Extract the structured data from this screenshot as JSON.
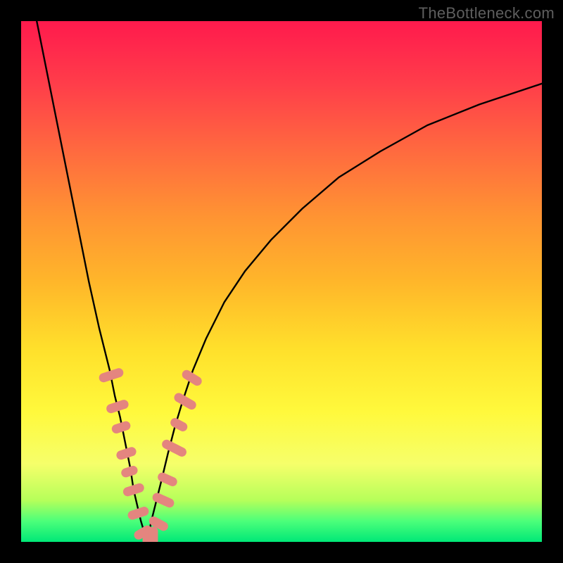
{
  "watermark": "TheBottleneck.com",
  "colors": {
    "frame": "#000000",
    "curve": "#000000",
    "marker_fill": "#e4857f",
    "marker_stroke": "#d46a63",
    "gradient_stops": [
      {
        "offset": 0.0,
        "color": "#ff1a4d"
      },
      {
        "offset": 0.12,
        "color": "#ff3d4a"
      },
      {
        "offset": 0.25,
        "color": "#ff6a3f"
      },
      {
        "offset": 0.37,
        "color": "#ff9233"
      },
      {
        "offset": 0.5,
        "color": "#ffb62a"
      },
      {
        "offset": 0.63,
        "color": "#ffe02b"
      },
      {
        "offset": 0.75,
        "color": "#fff93c"
      },
      {
        "offset": 0.85,
        "color": "#f6ff6a"
      },
      {
        "offset": 0.92,
        "color": "#b6ff5a"
      },
      {
        "offset": 0.96,
        "color": "#4cff7a"
      },
      {
        "offset": 1.0,
        "color": "#00e877"
      }
    ]
  },
  "chart_data": {
    "type": "line",
    "title": "",
    "xlabel": "",
    "ylabel": "",
    "xlim": [
      0,
      100
    ],
    "ylim": [
      0,
      100
    ],
    "series": [
      {
        "name": "bottleneck-curve-left",
        "x": [
          3,
          5,
          7,
          9,
          11,
          13,
          15,
          17,
          18,
          19,
          20,
          21,
          21.6,
          22.3,
          23,
          23.6,
          24.2
        ],
        "y": [
          100,
          90,
          80,
          70,
          60,
          50,
          41,
          33,
          28,
          24,
          19,
          14,
          10,
          7,
          4,
          2,
          0
        ]
      },
      {
        "name": "bottleneck-curve-right",
        "x": [
          24.2,
          25,
          26,
          27,
          28.2,
          29.5,
          31,
          33,
          35.5,
          39,
          43,
          48,
          54,
          61,
          69,
          78,
          88,
          100
        ],
        "y": [
          0,
          4,
          8,
          12,
          17,
          22,
          27,
          33,
          39,
          46,
          52,
          58,
          64,
          70,
          75,
          80,
          84,
          88
        ]
      }
    ],
    "markers": [
      {
        "x": 17.3,
        "y": 32,
        "angle": -72,
        "len": 4.2
      },
      {
        "x": 18.5,
        "y": 26,
        "angle": -72,
        "len": 3.8
      },
      {
        "x": 19.2,
        "y": 22,
        "angle": -72,
        "len": 3.2
      },
      {
        "x": 20.2,
        "y": 17,
        "angle": -72,
        "len": 3.4
      },
      {
        "x": 20.8,
        "y": 13.5,
        "angle": -72,
        "len": 2.8
      },
      {
        "x": 21.6,
        "y": 10,
        "angle": -72,
        "len": 3.6
      },
      {
        "x": 22.5,
        "y": 5.5,
        "angle": -72,
        "len": 3.6
      },
      {
        "x": 23.4,
        "y": 1.8,
        "angle": -60,
        "len": 3.2
      },
      {
        "x": 24.2,
        "y": 0.6,
        "angle": 0,
        "len": 3.2
      },
      {
        "x": 25.4,
        "y": 1.1,
        "angle": 0,
        "len": 3.2
      },
      {
        "x": 26.4,
        "y": 3.5,
        "angle": 62,
        "len": 3.4
      },
      {
        "x": 27.3,
        "y": 8,
        "angle": 66,
        "len": 3.8
      },
      {
        "x": 28.1,
        "y": 12,
        "angle": 66,
        "len": 3.4
      },
      {
        "x": 29.4,
        "y": 18,
        "angle": 63,
        "len": 4.4
      },
      {
        "x": 30.3,
        "y": 22.5,
        "angle": 62,
        "len": 3.0
      },
      {
        "x": 31.5,
        "y": 27,
        "angle": 60,
        "len": 4.0
      },
      {
        "x": 32.8,
        "y": 31.5,
        "angle": 58,
        "len": 3.6
      }
    ]
  }
}
